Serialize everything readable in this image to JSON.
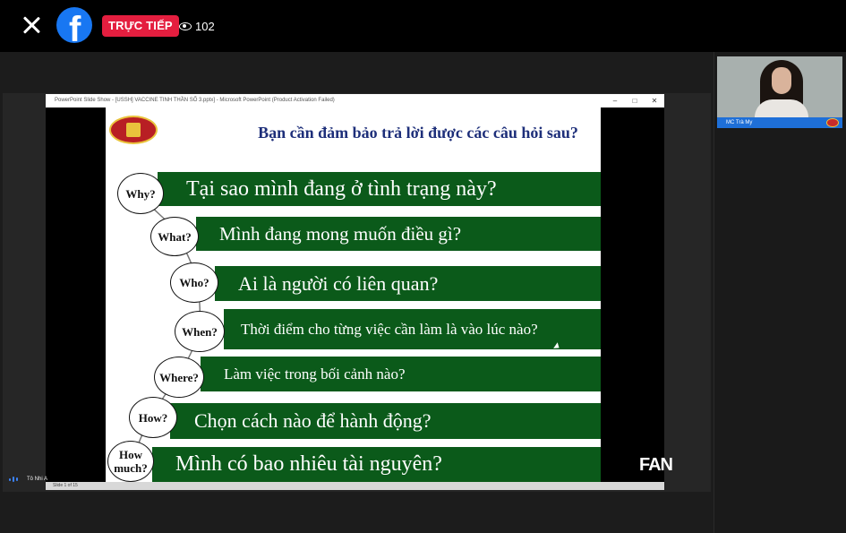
{
  "header": {
    "live_label": "TRỰC TIẾP",
    "viewer_count": "102"
  },
  "ppt": {
    "window_title": "PowerPoint Slide Show - [USSH] VACCINE TINH THẦN SỐ 3.pptx] - Microsoft PowerPoint (Product Activation Failed)",
    "status_text": "Slide 1 of 15"
  },
  "slide": {
    "title": "Bạn cần đảm bảo trả lời được các câu hỏi sau?",
    "items": [
      {
        "bubble": "Why?",
        "text": "Tại sao mình đang ở tình trạng này?"
      },
      {
        "bubble": "What?",
        "text": "Mình đang mong muốn điều gì?"
      },
      {
        "bubble": "Who?",
        "text": "Ai là người có liên quan?"
      },
      {
        "bubble": "When?",
        "text": "Thời điểm cho từng việc cần làm là vào lúc nào?"
      },
      {
        "bubble": "Where?",
        "text": "Làm việc trong bối cảnh nào?"
      },
      {
        "bubble": "How?",
        "text": "Chọn cách nào để hành động?"
      },
      {
        "bubble": "How much?",
        "text": "Mình có bao nhiêu tài nguyên?"
      }
    ]
  },
  "camera": {
    "label": "MC Trà My"
  },
  "presenter": {
    "name": "Tô Nhi A"
  },
  "watermark": {
    "text": "FAN"
  },
  "colors": {
    "bar_green": "#0b5a1a",
    "slide_title": "#1e2f7a",
    "live_red": "#e41e3f",
    "facebook_blue": "#1877f2"
  },
  "icons": [
    "close-icon",
    "facebook-logo-icon",
    "eye-icon",
    "mic-icon"
  ]
}
